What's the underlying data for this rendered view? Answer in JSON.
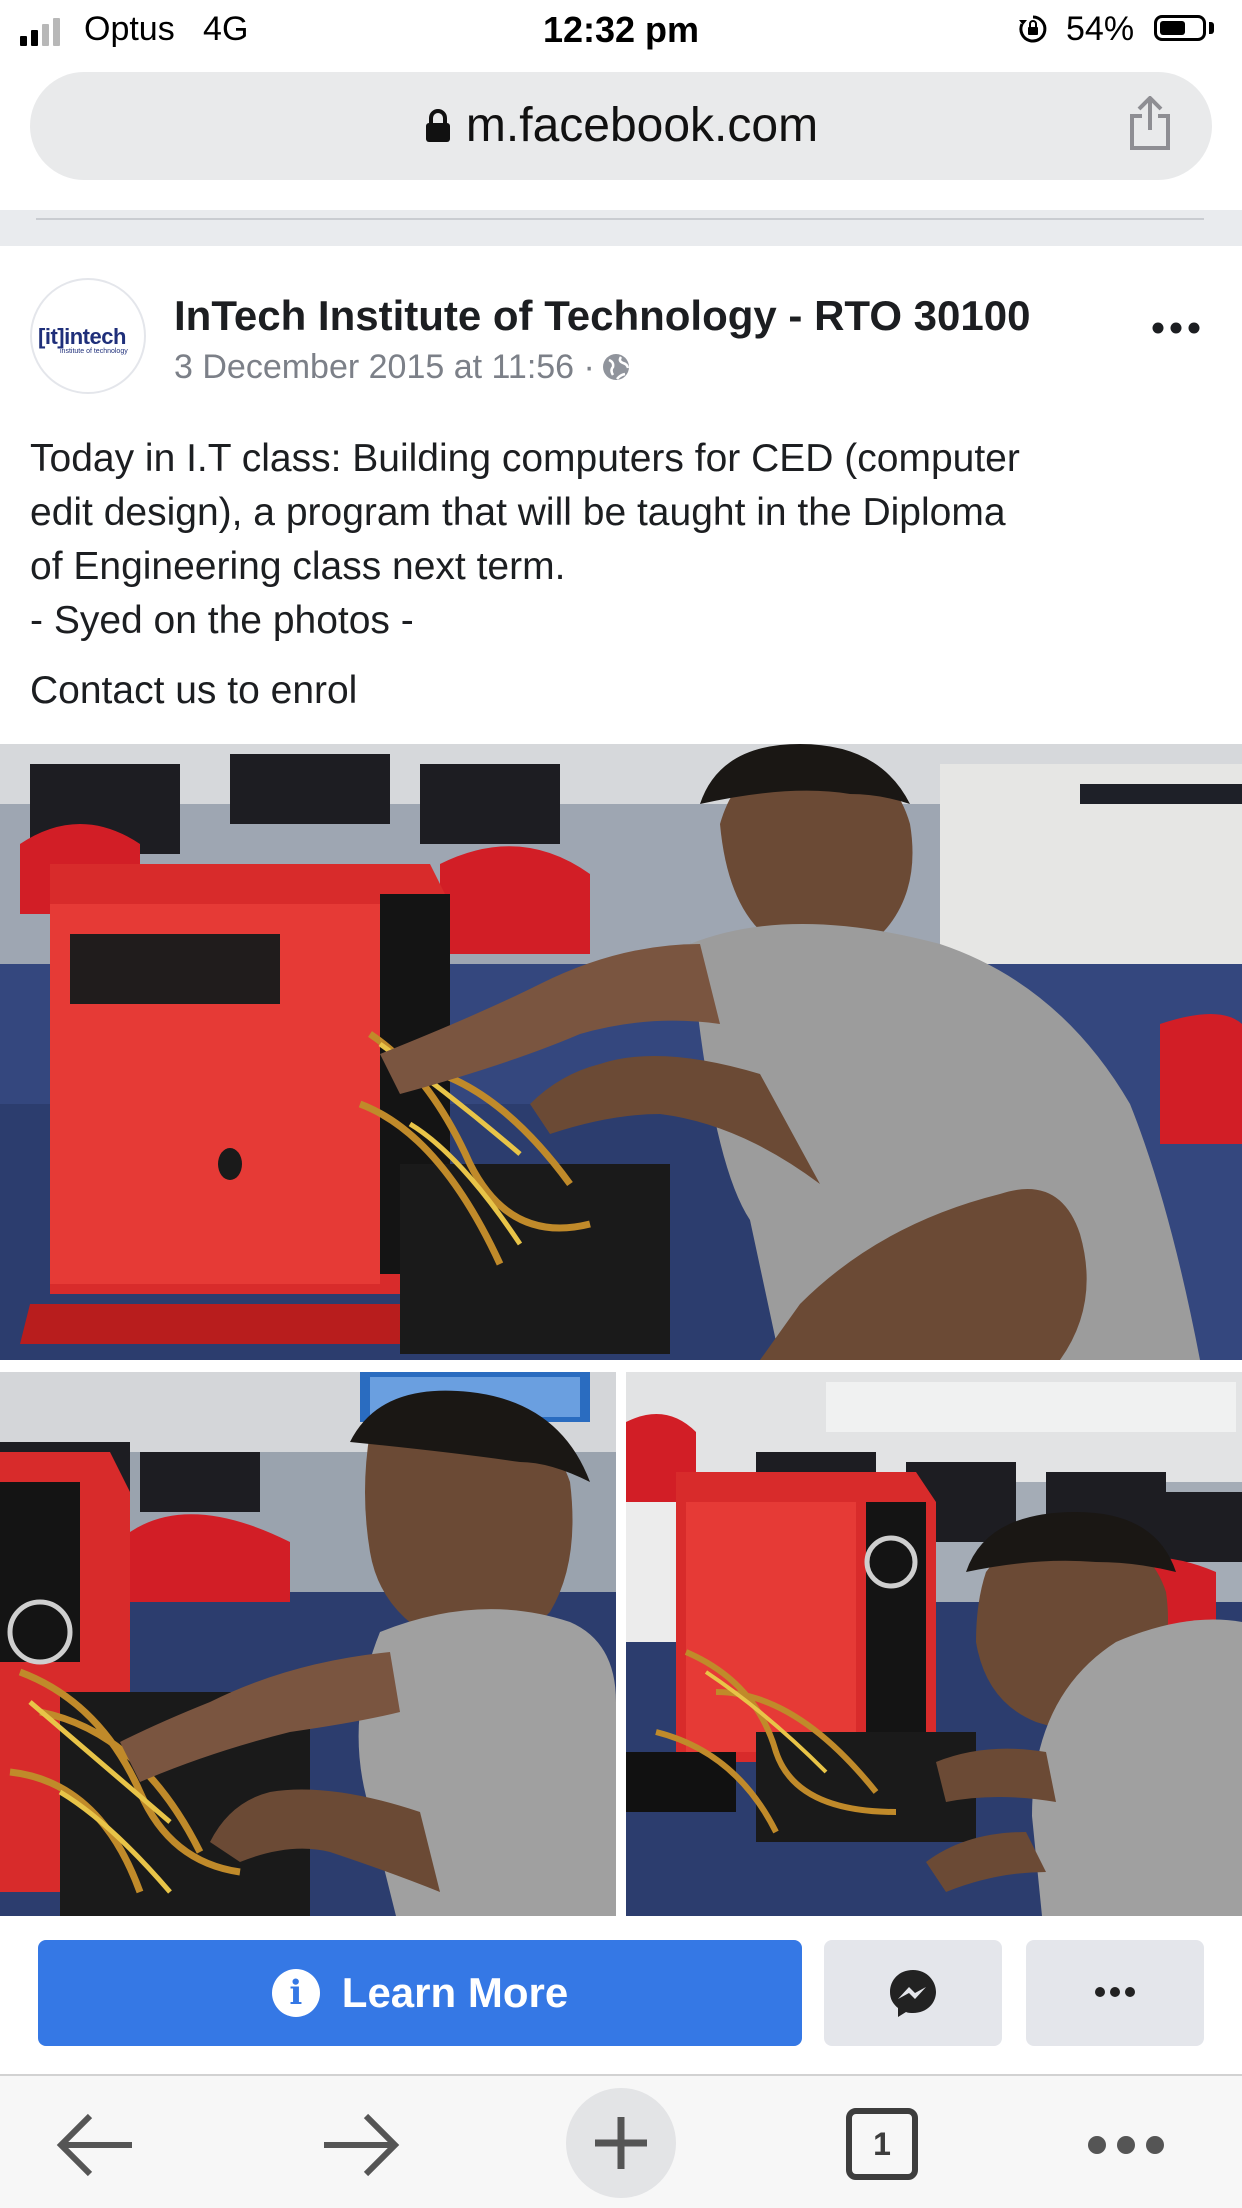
{
  "status_bar": {
    "carrier": "Optus   4G",
    "time": "12:32 pm",
    "battery_percent": "54%",
    "battery_level": 0.54,
    "signal_bars_filled": 2,
    "icons": [
      "signal-icon",
      "orientation-lock-icon",
      "battery-icon"
    ]
  },
  "browser": {
    "url": "m.facebook.com",
    "icons": [
      "lock-icon",
      "share-icon"
    ]
  },
  "post": {
    "page_name": "InTech Institute of Technology - RTO 30100",
    "timestamp": "3 December 2015 at 11:56 ·",
    "avatar_logo": "[it]intech",
    "avatar_logo_sub": "institute of technology",
    "text_lines": [
      "Today in I.T class: Building computers for CED (computer",
      "edit design), a program that will be taught in the Diploma",
      "of Engineering class next term.",
      "- Syed on the photos -"
    ],
    "contact_text": "Contact us to enrol",
    "photos": [
      "photo-main",
      "photo-left",
      "photo-right"
    ]
  },
  "actions": {
    "learn_more_label": "Learn More",
    "accent_color": "#3578e5",
    "icons": [
      "info-icon",
      "messenger-icon",
      "more-icon"
    ]
  },
  "toolbar": {
    "tab_count": "1",
    "icons": [
      "back-arrow-icon",
      "forward-arrow-icon",
      "new-tab-plus-icon",
      "tabs-icon",
      "more-icon"
    ]
  }
}
